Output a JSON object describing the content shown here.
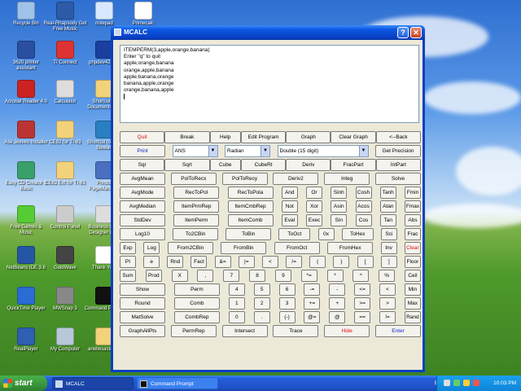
{
  "colors": {
    "accent": "#0a3fc2",
    "red_text": "#dd1111",
    "blue_text": "#1122cc"
  },
  "desktop_icons": [
    {
      "label": "Recycle Bin",
      "icon": "recycle-bin-icon",
      "color": "#9fc3e8"
    },
    {
      "label": "Real-Rhapsody Get Free Music",
      "icon": "music-icon",
      "color": "#2d5ba8"
    },
    {
      "label": "notepad",
      "icon": "notepad-icon",
      "color": "#d9e8ff"
    },
    {
      "label": "Primecalc",
      "icon": "calc-icon",
      "color": "#ffffff"
    },
    {
      "label": "3620 printer assistant",
      "icon": "hp-icon",
      "color": "#2a4fa0"
    },
    {
      "label": "TI Connect",
      "icon": "ti-icon",
      "color": "#d33"
    },
    {
      "label": "phpdev423-…",
      "icon": "php-icon",
      "color": "#1a3f9f"
    },
    {
      "label": "Acrobat Reader 4.0",
      "icon": "acrobat-icon",
      "color": "#c22"
    },
    {
      "label": "Calculator",
      "icon": "calculator-icon",
      "color": "#ddd"
    },
    {
      "label": "Shortcut to Documents a…",
      "icon": "folder-icon",
      "color": "#f2d27a"
    },
    {
      "label": "Ask Jeeves Installer",
      "icon": "jeeves-icon",
      "color": "#b33"
    },
    {
      "label": "CE82 for TI-83",
      "icon": "folder-icon",
      "color": "#f2d27a"
    },
    {
      "label": "Shortcut to PJR Stewart",
      "icon": "app-icon",
      "color": "#2a7fc0"
    },
    {
      "label": "Easy CD Creator 5 Basic",
      "icon": "cd-icon",
      "color": "#3aa06a"
    },
    {
      "label": "CE82 Ext for TI-83",
      "icon": "folder-icon",
      "color": "#f2d27a"
    },
    {
      "label": "Presto! PageManager",
      "icon": "scanner-icon",
      "color": "#4b6fbf"
    },
    {
      "label": "Free Games & Music",
      "icon": "games-icon",
      "color": "#5c3"
    },
    {
      "label": "Control Panel",
      "icon": "control-panel-icon",
      "color": "#ccc"
    },
    {
      "label": "Business Card Designer Plus",
      "icon": "card-icon",
      "color": "#ddd"
    },
    {
      "label": "NetBeans IDE 3.6",
      "icon": "netbeans-icon",
      "color": "#2456a5"
    },
    {
      "label": "GoldWave",
      "icon": "goldwave-icon",
      "color": "#444"
    },
    {
      "label": "Thank You!",
      "icon": "document-icon",
      "color": "#fff"
    },
    {
      "label": "QuickTime Player",
      "icon": "quicktime-icon",
      "color": "#2a6bd4"
    },
    {
      "label": "MWSnap 3",
      "icon": "camera-icon",
      "color": "#888"
    },
    {
      "label": "Command Prompt",
      "icon": "cmd-icon",
      "color": "#111"
    },
    {
      "label": "RealPlayer",
      "icon": "realplayer-icon",
      "color": "#2e5fb0"
    },
    {
      "label": "My Computer",
      "icon": "computer-icon",
      "color": "#b8c8d8"
    },
    {
      "label": "ariellesastrol…",
      "icon": "folder-icon",
      "color": "#f2d27a"
    }
  ],
  "window": {
    "title": "MCALC",
    "help_label": "?",
    "close_label": "✕"
  },
  "output_lines": [
    "ITEMPERM(3,apple,orange,banana)",
    "Enter \"q\" to quit",
    "apple,orange,banana",
    "orange,apple,banana",
    "apple,banana,orange",
    "banana,apple,orange",
    "orange,banana,apple"
  ],
  "rows": [
    [
      {
        "l": "Quit",
        "w": "lg",
        "c": "red"
      },
      {
        "l": "Break",
        "w": "lg"
      },
      {
        "l": "Help",
        "w": "md"
      },
      {
        "l": "Edit Program",
        "w": "lg"
      },
      {
        "l": "Graph",
        "w": "lg"
      },
      {
        "l": "Clear Graph",
        "w": "lg"
      },
      {
        "l": "<--Back",
        "w": "lg"
      }
    ],
    [
      {
        "l": "Print",
        "w": "lg",
        "c": "blue"
      },
      {
        "sel": "ANS",
        "w": "lg"
      },
      {
        "sel": "Radian",
        "w": "lg"
      },
      {
        "sel": "Double (15 digit)",
        "w": "xl"
      },
      {
        "l": "Get Precision",
        "w": "lg"
      }
    ],
    [
      {
        "l": "Sqr",
        "w": "lg"
      },
      {
        "l": "Sqrt",
        "w": "lg"
      },
      {
        "l": "Cube",
        "w": "md"
      },
      {
        "l": "CubeRt",
        "w": "lg"
      },
      {
        "l": "Deriv",
        "w": "lg"
      },
      {
        "l": "FracPart",
        "w": "lg"
      },
      {
        "l": "IntPart",
        "w": "lg"
      }
    ],
    [
      {
        "l": "AvgMean",
        "w": "lg"
      },
      {
        "l": "PolToRecx",
        "w": "lg"
      },
      {
        "l": "PolToRecy",
        "w": "lg"
      },
      {
        "l": "Deriv2",
        "w": "lg"
      },
      {
        "l": "Integ",
        "w": "lg"
      },
      {
        "l": "Solve",
        "w": "lg"
      }
    ],
    [
      {
        "l": "AvgMode",
        "w": "lg"
      },
      {
        "l": "RecToPol",
        "w": "lg"
      },
      {
        "l": "RecToPola",
        "w": "lg"
      },
      {
        "l": "And",
        "w": "sm"
      },
      {
        "l": "Or",
        "w": "sm"
      },
      {
        "l": "Sinh",
        "w": "sm"
      },
      {
        "l": "Cosh",
        "w": "sm"
      },
      {
        "l": "Tanh",
        "w": "sm"
      },
      {
        "l": "Fmin",
        "w": "sm"
      }
    ],
    [
      {
        "l": "AvgMedian",
        "w": "lg"
      },
      {
        "l": "ItemPrmRep",
        "w": "lg"
      },
      {
        "l": "ItemCmbRep",
        "w": "lg"
      },
      {
        "l": "Not",
        "w": "sm"
      },
      {
        "l": "Xor",
        "w": "sm"
      },
      {
        "l": "Asin",
        "w": "sm"
      },
      {
        "l": "Acos",
        "w": "sm"
      },
      {
        "l": "Atan",
        "w": "sm"
      },
      {
        "l": "Fmax",
        "w": "sm"
      }
    ],
    [
      {
        "l": "StdDev",
        "w": "lg"
      },
      {
        "l": "ItemPerm",
        "w": "lg"
      },
      {
        "l": "ItemComb",
        "w": "lg"
      },
      {
        "l": "Eval",
        "w": "sm"
      },
      {
        "l": "Exec",
        "w": "sm"
      },
      {
        "l": "Sin",
        "w": "sm"
      },
      {
        "l": "Cos",
        "w": "sm"
      },
      {
        "l": "Tan",
        "w": "sm"
      },
      {
        "l": "Abs",
        "w": "sm"
      }
    ],
    [
      {
        "l": "Log10",
        "w": "lg"
      },
      {
        "l": "To2CBin",
        "w": "lg"
      },
      {
        "l": "ToBin",
        "w": "lg"
      },
      {
        "l": "ToOct",
        "w": "md"
      },
      {
        "l": "0x",
        "w": "sm"
      },
      {
        "l": "ToHex",
        "w": "md"
      },
      {
        "l": "Sci",
        "w": "sm"
      },
      {
        "l": "Frac",
        "w": "sm"
      }
    ],
    [
      {
        "l": "Exp",
        "w": "sm"
      },
      {
        "l": "Log",
        "w": "sm"
      },
      {
        "l": "From2CBin",
        "w": "lg"
      },
      {
        "l": "FromBin",
        "w": "lg"
      },
      {
        "l": "FromOct",
        "w": "lg"
      },
      {
        "l": "FromHex",
        "w": "lg"
      },
      {
        "l": "Inv",
        "w": "sm"
      },
      {
        "l": "Clear",
        "w": "sm",
        "c": "red"
      }
    ],
    [
      {
        "l": "PI",
        "w": "sm"
      },
      {
        "l": "e",
        "w": "sm"
      },
      {
        "l": "Rnd",
        "w": "sm"
      },
      {
        "l": "Fact",
        "w": "sm"
      },
      {
        "l": "&=",
        "w": "sm"
      },
      {
        "l": "|=",
        "w": "sm"
      },
      {
        "l": "<",
        "w": "sm"
      },
      {
        "l": "/=",
        "w": "sm"
      },
      {
        "l": "(",
        "w": "sm"
      },
      {
        "l": ")",
        "w": "sm"
      },
      {
        "l": "[",
        "w": "sm"
      },
      {
        "l": "]",
        "w": "sm"
      },
      {
        "l": "Floor",
        "w": "sm"
      }
    ],
    [
      {
        "l": "Sum",
        "w": "sm"
      },
      {
        "l": "Prod",
        "w": "sm"
      },
      {
        "l": "X",
        "w": "sm"
      },
      {
        "l": ",",
        "w": "sm"
      },
      {
        "l": "7",
        "w": "sm"
      },
      {
        "l": "8",
        "w": "sm"
      },
      {
        "l": "9",
        "w": "sm"
      },
      {
        "l": "*=",
        "w": "sm"
      },
      {
        "l": "*",
        "w": "sm"
      },
      {
        "l": "^",
        "w": "sm"
      },
      {
        "l": "%",
        "w": "sm"
      },
      {
        "l": "Ceil",
        "w": "sm"
      }
    ],
    [
      {
        "l": "Show",
        "w": "lg"
      },
      {
        "l": "Perm",
        "w": "lg"
      },
      {
        "l": "4",
        "w": "sm"
      },
      {
        "l": "5",
        "w": "sm"
      },
      {
        "l": "6",
        "w": "sm"
      },
      {
        "l": "-=",
        "w": "sm"
      },
      {
        "l": "-",
        "w": "sm"
      },
      {
        "l": "<=",
        "w": "sm"
      },
      {
        "l": "<",
        "w": "sm"
      },
      {
        "l": "Min",
        "w": "sm"
      }
    ],
    [
      {
        "l": "Round",
        "w": "lg"
      },
      {
        "l": "Comb",
        "w": "lg"
      },
      {
        "l": "1",
        "w": "sm"
      },
      {
        "l": "2",
        "w": "sm"
      },
      {
        "l": "3",
        "w": "sm"
      },
      {
        "l": "+=",
        "w": "sm"
      },
      {
        "l": "+",
        "w": "sm"
      },
      {
        "l": ">=",
        "w": "sm"
      },
      {
        "l": ">",
        "w": "sm"
      },
      {
        "l": "Max",
        "w": "sm"
      }
    ],
    [
      {
        "l": "MatSolve",
        "w": "lg"
      },
      {
        "l": "CombRep",
        "w": "lg"
      },
      {
        "l": "0",
        "w": "sm"
      },
      {
        "l": ".",
        "w": "sm"
      },
      {
        "l": "(-)",
        "w": "sm"
      },
      {
        "l": "@=",
        "w": "sm"
      },
      {
        "l": "@",
        "w": "sm"
      },
      {
        "l": "==",
        "w": "sm"
      },
      {
        "l": "!=",
        "w": "sm"
      },
      {
        "l": "Rand",
        "w": "sm"
      }
    ],
    [
      {
        "l": "GraphAllPts",
        "w": "lg"
      },
      {
        "l": "PermRep",
        "w": "lg"
      },
      {
        "l": "Intersect",
        "w": "lg"
      },
      {
        "l": "Trace",
        "w": "lg"
      },
      {
        "l": "Hide",
        "w": "lg",
        "c": "red"
      },
      {
        "l": "Enter",
        "w": "lg",
        "c": "blue"
      }
    ]
  ],
  "taskbar": {
    "start_label": "start",
    "tasks": [
      {
        "label": "MCALC",
        "active": true
      },
      {
        "label": "Command Prompt",
        "active": false
      }
    ],
    "language": "EN",
    "clock": "10:03 PM"
  }
}
